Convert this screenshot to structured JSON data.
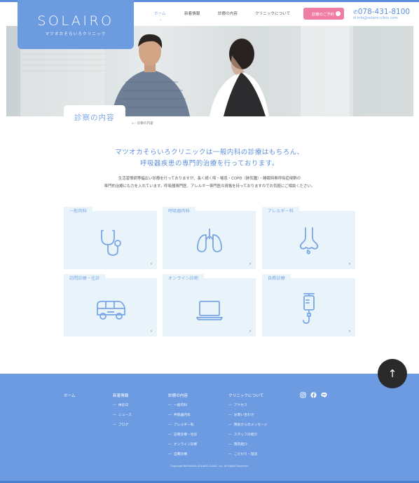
{
  "header": {
    "logo_main": "SOLAIRO",
    "logo_sub": "マツオカそらいろクリニック",
    "nav": [
      "ホーム",
      "新着情報",
      "診療の内容",
      "クリニックについて"
    ],
    "reserve_label": "診療のご予約",
    "phone": "078-431-8100",
    "mail": "info@solairo-clinic.com"
  },
  "page": {
    "title": "診察の内容",
    "breadcrumb": [
      "診察の内容"
    ]
  },
  "intro": {
    "lead_line1": "マツオカそらいろクリニックは一般内科の診療はもちろん、",
    "lead_line2": "呼吸器疾患の専門的治療を行っております。",
    "desc_line1": "生活習慣病等幅広い診療を行っておりますが、長く続く咳・喘息・COPD（肺気腫）・睡眠時無呼吸症候群の",
    "desc_line2": "専門的治療にも力を入れています。呼吸器専門医、アレルギー専門医の資格を持っておりますのでお気軽にご相談ください。"
  },
  "cards": [
    {
      "label": "一般内科",
      "icon": "stethoscope-icon"
    },
    {
      "label": "呼吸器内科",
      "icon": "lungs-icon"
    },
    {
      "label": "アレルギー科",
      "icon": "nose-icon"
    },
    {
      "label": "訪問診療・往診",
      "icon": "van-icon"
    },
    {
      "label": "オンライン診断",
      "icon": "laptop-icon"
    },
    {
      "label": "自費診療",
      "icon": "iv-drip-icon"
    }
  ],
  "footer": {
    "home": "ホーム",
    "news_title": "新着情報",
    "news_items": [
      "休診日",
      "ニュース",
      "ブログ"
    ],
    "services_title": "診療の内容",
    "services_items": [
      "一般内科",
      "呼吸器内科",
      "アレルギー科",
      "訪問診療・往診",
      "オンライン診断",
      "自費診療"
    ],
    "about_title": "クリニックについて",
    "about_items": [
      "アクセス",
      "お問い合わせ",
      "院長からのメッセージ",
      "スタッフの紹介",
      "院内紹介",
      "こだわり・理念"
    ],
    "copyright": "Copyright MATSUOKA SOLAIRO CLINIC. Inc. All Rights Reserved."
  },
  "colors": {
    "accent": "#6d9be0",
    "pink": "#f07ea4",
    "card_bg": "#e9f4fa",
    "footer_bg": "#6c9be1"
  }
}
